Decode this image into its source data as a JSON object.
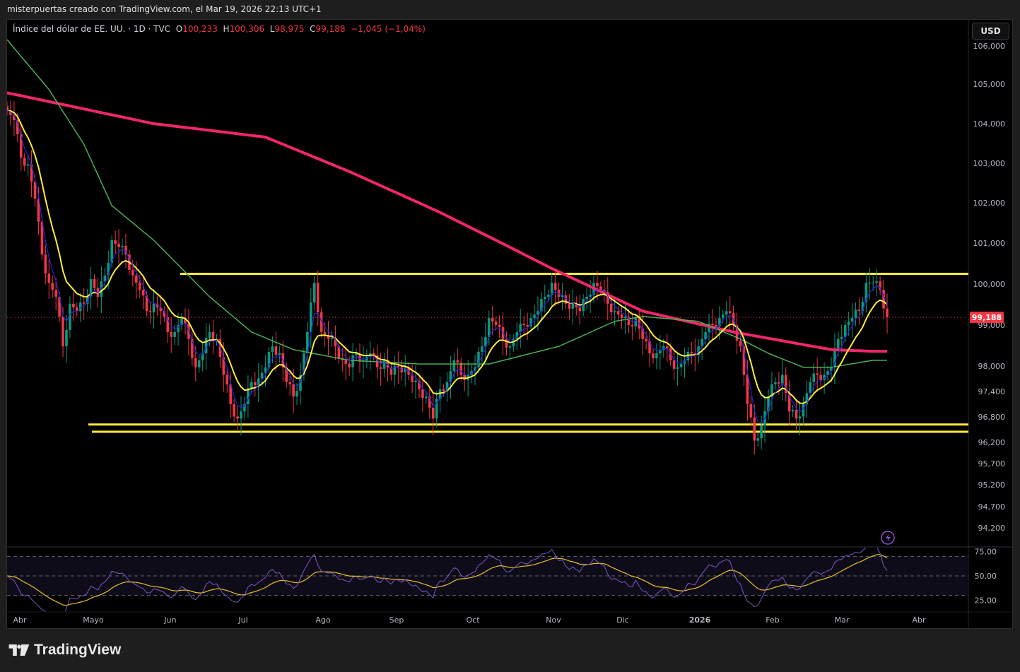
{
  "caption": "misterpuertas creado con TradingView.com, el Mar 19, 2026 22:13 UTC+1",
  "legend": {
    "symbol": "Índice del dólar de EE. UU. · 1D · TVC",
    "o_label": "O",
    "o": "100,233",
    "h_label": "H",
    "h": "100,306",
    "l_label": "L",
    "l": "98,975",
    "c_label": "C",
    "c": "99,188",
    "change": "−1,045 (−1,04%)"
  },
  "currency_button": "USD",
  "brand": "TradingView",
  "colors": {
    "up": "#089981",
    "down": "#f23645",
    "ema_fast": "#2424d6",
    "ema_mid": "#ffeb3b",
    "ma_green": "#4caf50",
    "ma_pink": "#f0266a",
    "levels": "#ffeb3b",
    "rsi": "#7e57c2",
    "rsi_ma": "#e6c229"
  },
  "chart_data": {
    "type": "candlestick",
    "title": "Índice del dólar de EE. UU. · 1D · TVC",
    "price_ticks": [
      "106,000",
      "105,000",
      "104,000",
      "103,000",
      "102,000",
      "101,000",
      "100,000",
      "99,000",
      "98,000",
      "97,400",
      "96,800",
      "96,200",
      "95,700",
      "95,200",
      "94,700",
      "94,200"
    ],
    "price_tick_values": [
      106,
      105,
      104,
      103,
      102,
      101,
      100,
      99,
      98,
      97.4,
      96.8,
      96.2,
      95.7,
      95.2,
      94.7,
      94.2
    ],
    "time_ticks": [
      "Abr",
      "Mayo",
      "Jun",
      "Jul",
      "Ago",
      "Sep",
      "Oct",
      "Nov",
      "Dic",
      "2026",
      "Feb",
      "Mar",
      "Abr"
    ],
    "current_price": 99.188,
    "current_price_label": "99,188",
    "closes": [
      104.34,
      104.09,
      103.14,
      102.97,
      102.1,
      100.72,
      100.03,
      99.69,
      98.48,
      99.52,
      99.34,
      99.52,
      100.12,
      99.69,
      100.21,
      101.07,
      100.9,
      100.72,
      100.21,
      99.86,
      99.34,
      99.52,
      99.34,
      98.83,
      98.83,
      99.17,
      98.66,
      97.97,
      98.31,
      98.83,
      98.66,
      97.79,
      97.1,
      96.76,
      97.1,
      97.62,
      97.71,
      97.97,
      98.48,
      98.31,
      97.62,
      97.28,
      97.79,
      98.83,
      100.03,
      98.83,
      98.66,
      98.48,
      98.14,
      97.97,
      98.31,
      98.14,
      98.31,
      97.97,
      98.14,
      97.79,
      97.97,
      97.97,
      97.62,
      97.45,
      97.28,
      96.76,
      97.45,
      97.62,
      98.14,
      97.79,
      97.79,
      97.97,
      98.48,
      99.17,
      99.0,
      98.66,
      98.48,
      98.83,
      99.0,
      99.17,
      99.34,
      99.69,
      100.03,
      99.69,
      99.52,
      99.52,
      99.34,
      99.69,
      100.03,
      99.86,
      99.52,
      99.34,
      99.17,
      99.0,
      99.17,
      98.66,
      98.31,
      98.31,
      98.48,
      98.14,
      97.97,
      98.14,
      98.31,
      98.48,
      98.83,
      99.0,
      99.17,
      99.34,
      99.0,
      98.48,
      97.1,
      96.24,
      96.59,
      97.28,
      97.62,
      97.79,
      96.93,
      96.76,
      97.1,
      97.62,
      97.79,
      97.79,
      97.97,
      98.66,
      99.0,
      99.17,
      99.34,
      100.03,
      100.03,
      99.86,
      99.19
    ],
    "ma_pink": {
      "idx": [
        0,
        21,
        37,
        49,
        62,
        78,
        91,
        104,
        118,
        124
      ],
      "values": [
        104.78,
        104.0,
        103.66,
        102.79,
        101.76,
        100.38,
        99.34,
        98.83,
        98.4,
        98.36
      ]
    },
    "ma_green": {
      "idx": [
        0,
        6,
        11,
        15,
        21,
        29,
        35,
        41,
        49,
        59,
        69,
        79,
        87,
        91,
        99,
        105,
        109,
        114,
        118,
        124
      ],
      "values": [
        106.16,
        104.86,
        103.48,
        101.93,
        101.07,
        99.69,
        98.83,
        98.4,
        98.14,
        98.05,
        98.05,
        98.48,
        99.09,
        99.21,
        99.09,
        98.66,
        98.31,
        97.97,
        97.97,
        98.14
      ]
    },
    "horizontal_levels": [
      100.25,
      96.62,
      96.45
    ],
    "rsi": {
      "ticks": [
        "75,00",
        "50,00",
        "25,00"
      ],
      "tick_values": [
        75,
        50,
        25
      ],
      "band": [
        70,
        30
      ]
    }
  }
}
